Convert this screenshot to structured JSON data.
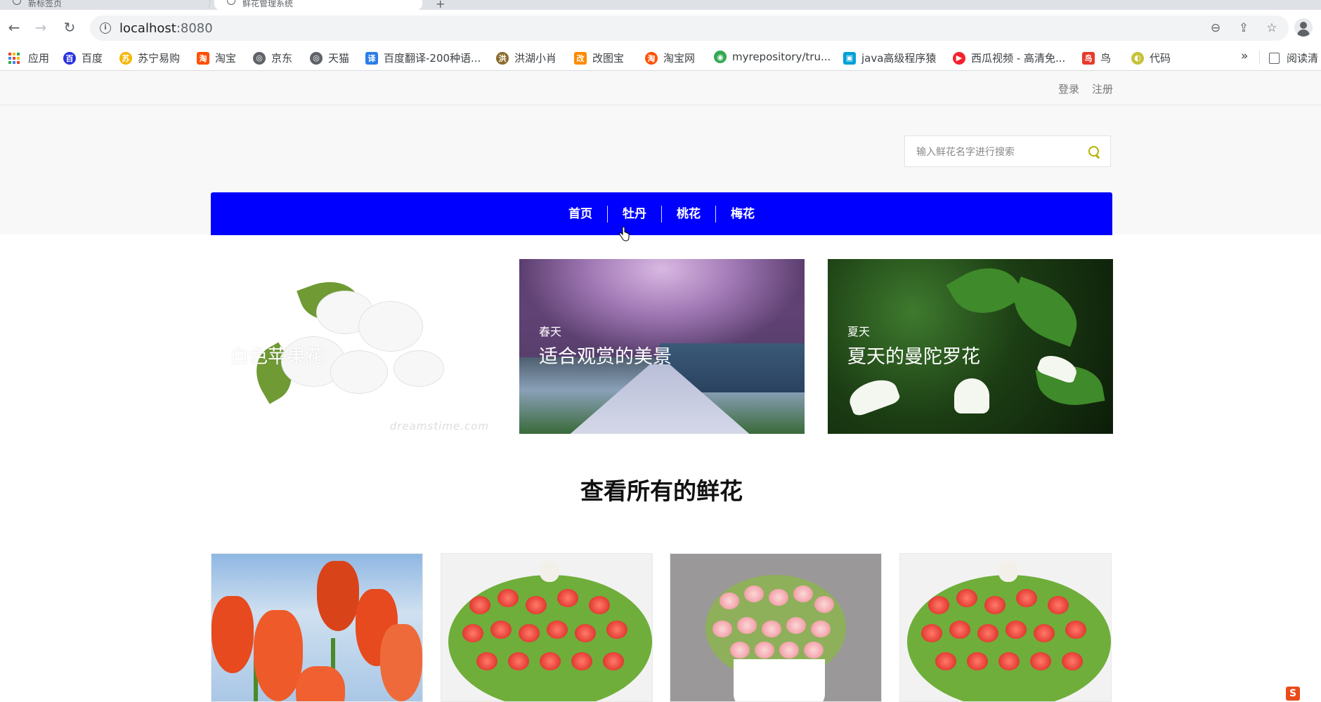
{
  "browser": {
    "tabs": [
      {
        "label": "新标签页"
      },
      {
        "label": "鲜花管理系统"
      }
    ],
    "address": {
      "host": "localhost",
      "port": ":8080"
    },
    "bookmarks": [
      {
        "label": "应用",
        "color": "#1a73e8"
      },
      {
        "label": "百度",
        "color": "#2932e1"
      },
      {
        "label": "苏宁易购",
        "color": "#f7b500"
      },
      {
        "label": "淘宝",
        "color": "#ff5000"
      },
      {
        "label": "京东",
        "color": "#5f6368"
      },
      {
        "label": "天猫",
        "color": "#5f6368"
      },
      {
        "label": "百度翻译-200种语...",
        "color": "#2b7de9"
      },
      {
        "label": "洪湖小肖",
        "color": "#8a6a2a"
      },
      {
        "label": "改图宝",
        "color": "#ff8a00"
      },
      {
        "label": "淘宝网",
        "color": "#ff5000"
      },
      {
        "label": "myrepository/tru...",
        "color": "#34a853"
      },
      {
        "label": "java高级程序猿",
        "color": "#00a1d6"
      },
      {
        "label": "西瓜视频 - 高清免...",
        "color": "#f5222d"
      },
      {
        "label": "鸟",
        "color": "#e83a2a"
      },
      {
        "label": "代码",
        "color": "#c7c23a"
      }
    ],
    "more": "»",
    "reader": "阅读清"
  },
  "top": {
    "login": "登录",
    "register": "注册"
  },
  "search": {
    "placeholder": "输入鲜花名字进行搜索"
  },
  "nav": [
    "首页",
    "牡丹",
    "桃花",
    "梅花"
  ],
  "banners": [
    {
      "sub": "",
      "title": "白色苹果花",
      "watermark": "dreamstime.com"
    },
    {
      "sub": "春天",
      "title": "适合观赏的美景"
    },
    {
      "sub": "夏天",
      "title": "夏天的曼陀罗花"
    }
  ],
  "section_title": "查看所有的鲜花",
  "corner_badge": "S"
}
